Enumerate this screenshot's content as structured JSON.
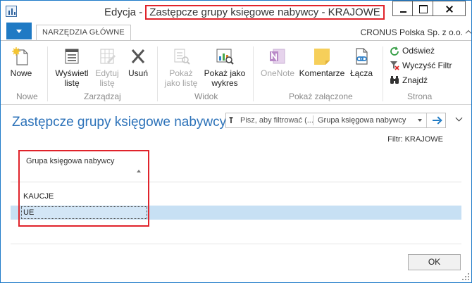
{
  "window": {
    "title_prefix": "Edycja -",
    "title_highlight": "Zastępcze grupy księgowe nabywcy - KRAJOWE"
  },
  "tabbar": {
    "home_tab": "NARZĘDZIA GŁÓWNE",
    "company": "CRONUS Polska Sp. z o.o."
  },
  "ribbon": {
    "new": "Nowe",
    "group_new": "Nowe",
    "show_list_1": "Wyświetl",
    "show_list_2": "listę",
    "edit_list_1": "Edytuj",
    "edit_list_2": "listę",
    "delete": "Usuń",
    "group_manage": "Zarządzaj",
    "show_as_list_1": "Pokaż",
    "show_as_list_2": "jako listę",
    "show_as_chart_1": "Pokaż jako",
    "show_as_chart_2": "wykres",
    "group_view": "Widok",
    "onenote": "OneNote",
    "comments": "Komentarze",
    "links": "Łącza",
    "group_attachments": "Pokaż załączone",
    "refresh": "Odśwież",
    "clear_filter": "Wyczyść Filtr",
    "find": "Znajdź",
    "group_page": "Strona"
  },
  "list": {
    "title": "Zastępcze grupy księgowe nabywcy",
    "filter_placeholder": "Pisz, aby filtrować (...",
    "filter_field": "Grupa księgowa nabywcy",
    "filter_info": "Filtr: KRAJOWE",
    "column_header": "Grupa księgowa nabywcy",
    "rows": [
      "KAUCJE",
      "UE"
    ]
  },
  "footer": {
    "ok": "OK"
  }
}
